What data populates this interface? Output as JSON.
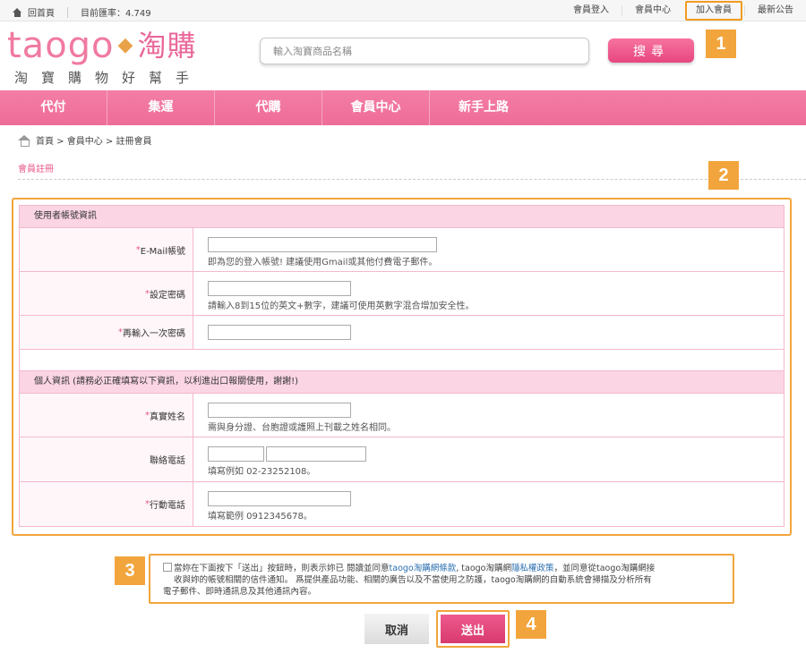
{
  "topbar": {
    "home_label": "回首頁",
    "rate_label": "目前匯率：4.749",
    "links": {
      "login": "會員登入",
      "member_center": "會員中心",
      "join": "加入會員",
      "news": "最新公告"
    }
  },
  "header": {
    "logo_en": "taogo",
    "logo_dot": "◆",
    "logo_zh": "淘購",
    "tagline": "淘寶購物好幫手",
    "search_placeholder": "輸入淘寶商品名稱",
    "search_button": "搜尋"
  },
  "nav": {
    "items": [
      "代付",
      "集運",
      "代購",
      "會員中心",
      "新手上路"
    ]
  },
  "breadcrumb": {
    "text": "首頁 > 會員中心 > 註冊會員"
  },
  "page_title": "會員註冊",
  "form": {
    "account_section": "使用者帳號資訊",
    "email_label": "E-Mail帳號",
    "email_hint": "即為您的登入帳號! 建議使用Gmail或其他付費電子郵件。",
    "password_label": "設定密碼",
    "password_hint": "請輸入8到15位的英文+數字，建議可使用英數字混合增加安全性。",
    "password2_label": "再輸入一次密碼",
    "personal_section": "個人資訊 (請務必正確填寫以下資訊，以利進出口報關使用，謝謝!)",
    "name_label": "真實姓名",
    "name_hint": "需與身分證、台胞證或護照上刊載之姓名相同。",
    "phone_label": "聯絡電話",
    "phone_hint": "填寫例如 02-23252108。",
    "mobile_label": "行動電話",
    "mobile_hint": "填寫範例 0912345678。",
    "required_mark": "*"
  },
  "terms": {
    "line1_a": "當妳在下面按下「送出」按鈕時，則表示妳已 閱讀並同意",
    "link1": "taogo淘購網條款",
    "line1_b": ", taogo淘購網",
    "link2": "隱私權政策",
    "line1_c": "，並同意從taogo淘購網接",
    "line2": "收與妳的帳號相關的信件通知。 爲提供產品功能、相關的廣告以及不當使用之防護，taogo淘購網的自動系統會掃描及分析所有",
    "line3": "電子郵件、即時通訊息及其他通訊內容。"
  },
  "buttons": {
    "cancel": "取消",
    "submit": "送出"
  },
  "badges": [
    "1",
    "2",
    "3",
    "4"
  ]
}
